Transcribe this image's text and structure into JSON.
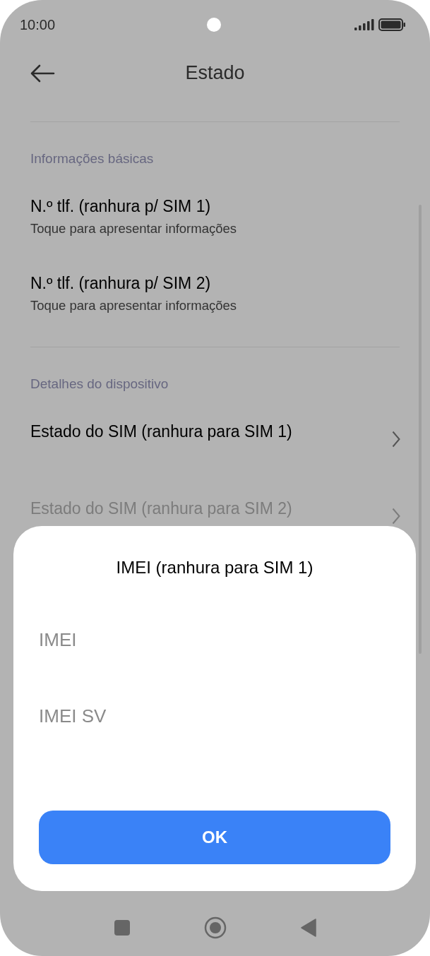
{
  "status_bar": {
    "time": "10:00"
  },
  "header": {
    "title": "Estado"
  },
  "sections": [
    {
      "title": "Informações básicas",
      "items": [
        {
          "kind": "info",
          "title": "N.º tlf. (ranhura p/ SIM 1)",
          "subtitle": "Toque para apresentar informações",
          "disabled": false
        },
        {
          "kind": "info",
          "title": "N.º tlf. (ranhura p/ SIM 2)",
          "subtitle": "Toque para apresentar informações",
          "disabled": false
        }
      ]
    },
    {
      "title": "Detalhes do dispositivo",
      "items": [
        {
          "kind": "link",
          "title": "Estado do SIM (ranhura para SIM 1)",
          "disabled": false
        },
        {
          "kind": "link",
          "title": "Estado do SIM (ranhura para SIM 2)",
          "disabled": true
        }
      ]
    }
  ],
  "dialog": {
    "title": "IMEI (ranhura para SIM 1)",
    "fields": [
      {
        "label": "IMEI"
      },
      {
        "label": "IMEI SV"
      }
    ],
    "button": "OK"
  }
}
